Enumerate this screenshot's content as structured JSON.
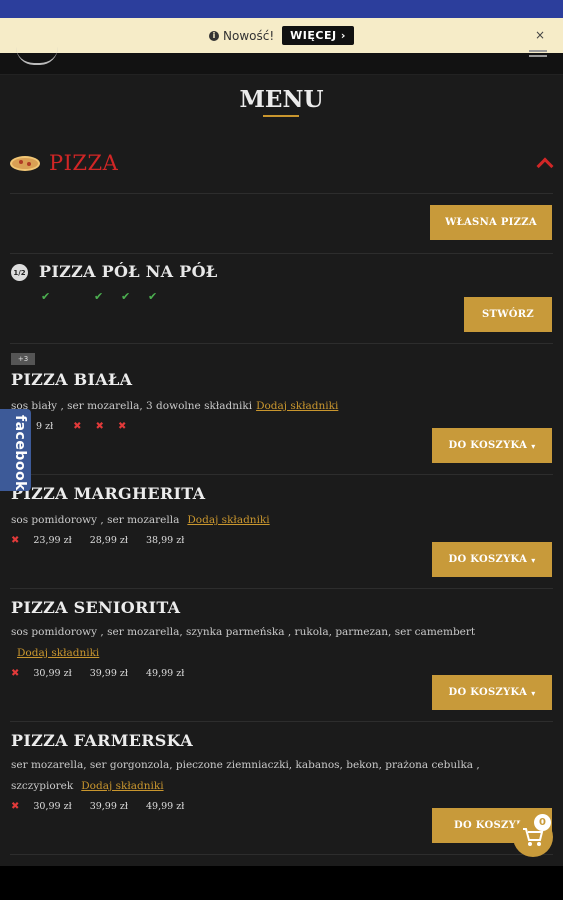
{
  "notice": {
    "text": "Nowość!",
    "more_label": "WIĘCEJ",
    "more_caret": "›",
    "close": "×",
    "info_glyph": "i"
  },
  "page": {
    "title": "MENU"
  },
  "category": {
    "name": "PIZZA",
    "own_pizza_label": "WŁASNA PIZZA"
  },
  "half_half": {
    "icon_label": "1/2",
    "title": "PIZZA PÓŁ NA PÓŁ",
    "create_label": "STWÓRZ"
  },
  "badge": "+3",
  "add_ingredients": "Dodaj składniki",
  "cart_button": "DO KOSZYKA",
  "caret": "▾",
  "items": [
    {
      "name": "PIZZA BIAŁA",
      "desc": "sos biały , ser mozarella, 3 dowolne składniki",
      "prices": [
        "9 zł"
      ]
    },
    {
      "name": "PIZZA MARGHERITA",
      "desc": "sos pomidorowy , ser mozarella",
      "prices": [
        "23,99 zł",
        "28,99 zł",
        "38,99 zł"
      ]
    },
    {
      "name": "PIZZA SENIORITA",
      "desc": "sos pomidorowy , ser mozarella, szynka parmeńska , rukola, parmezan, ser camembert",
      "prices": [
        "30,99 zł",
        "39,99 zł",
        "49,99 zł"
      ]
    },
    {
      "name": "PIZZA FARMERSKA",
      "desc_line1": "ser mozarella, ser gorgonzola, pieczone ziemniaczki, kabanos, bekon, prażona cebulka ,",
      "desc_line2": "szczypiorek",
      "prices": [
        "30,99 zł",
        "39,99 zł",
        "49,99 zł"
      ]
    }
  ],
  "facebook_label": "facebook",
  "cart": {
    "count": "0"
  }
}
